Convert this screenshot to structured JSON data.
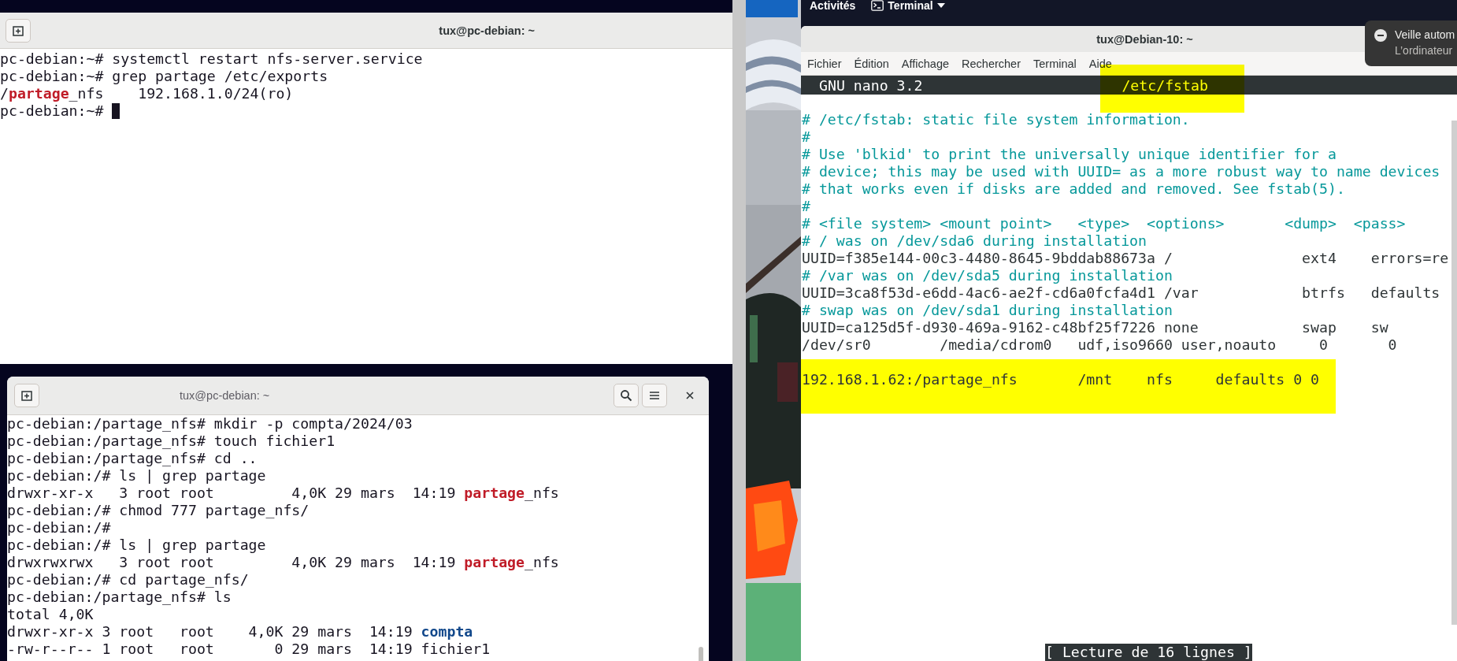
{
  "left_desktop": {
    "top_terminal": {
      "title": "tux@pc-debian: ~",
      "lines": [
        {
          "parts": [
            {
              "text": "pc-debian:~# systemctl restart nfs-server.service",
              "kind": "plain"
            }
          ],
          "cursor": false
        },
        {
          "parts": [
            {
              "text": "pc-debian:~# grep partage /etc/exports",
              "kind": "plain"
            }
          ],
          "cursor": false
        },
        {
          "parts": [
            {
              "text": "/",
              "kind": "plain"
            },
            {
              "text": "partage",
              "kind": "match"
            },
            {
              "text": "_nfs    192.168.1.0/24(ro)",
              "kind": "plain"
            }
          ],
          "cursor": false
        },
        {
          "parts": [
            {
              "text": "pc-debian:~#",
              "kind": "plain"
            }
          ],
          "cursor": true
        }
      ]
    },
    "bottom_terminal": {
      "title": "tux@pc-debian: ~",
      "lines": [
        {
          "parts": [
            {
              "text": "pc-debian:/partage_nfs# mkdir -p compta/2024/03",
              "kind": "plain"
            }
          ],
          "cursor": false
        },
        {
          "parts": [
            {
              "text": "pc-debian:/partage_nfs# touch fichier1",
              "kind": "plain"
            }
          ],
          "cursor": false
        },
        {
          "parts": [
            {
              "text": "pc-debian:/partage_nfs# cd ..",
              "kind": "plain"
            }
          ],
          "cursor": false
        },
        {
          "parts": [
            {
              "text": "pc-debian:/# ls | grep partage",
              "kind": "plain"
            }
          ],
          "cursor": false
        },
        {
          "parts": [
            {
              "text": "drwxr-xr-x   3 root root         4,0K 29 mars  14:19 ",
              "kind": "plain"
            },
            {
              "text": "partage",
              "kind": "match"
            },
            {
              "text": "_nfs",
              "kind": "plain"
            }
          ],
          "cursor": false
        },
        {
          "parts": [
            {
              "text": "pc-debian:/# chmod 777 partage_nfs/",
              "kind": "plain"
            }
          ],
          "cursor": false
        },
        {
          "parts": [
            {
              "text": "pc-debian:/#",
              "kind": "plain"
            }
          ],
          "cursor": false
        },
        {
          "parts": [
            {
              "text": "pc-debian:/# ls | grep partage",
              "kind": "plain"
            }
          ],
          "cursor": false
        },
        {
          "parts": [
            {
              "text": "drwxrwxrwx   3 root root         4,0K 29 mars  14:19 ",
              "kind": "plain"
            },
            {
              "text": "partage",
              "kind": "match"
            },
            {
              "text": "_nfs",
              "kind": "plain"
            }
          ],
          "cursor": false
        },
        {
          "parts": [
            {
              "text": "pc-debian:/# cd partage_nfs/",
              "kind": "plain"
            }
          ],
          "cursor": false
        },
        {
          "parts": [
            {
              "text": "pc-debian:/partage_nfs# ls",
              "kind": "plain"
            }
          ],
          "cursor": false
        },
        {
          "parts": [
            {
              "text": "total 4,0K",
              "kind": "plain"
            }
          ],
          "cursor": false
        },
        {
          "parts": [
            {
              "text": "drwxr-xr-x 3 root   root    4,0K 29 mars  14:19 ",
              "kind": "plain"
            },
            {
              "text": "compta",
              "kind": "dir"
            }
          ],
          "cursor": false
        },
        {
          "parts": [
            {
              "text": "-rw-r--r-- 1 root   root       0 29 mars  14:19 fichier1",
              "kind": "plain"
            }
          ],
          "cursor": false
        }
      ]
    }
  },
  "right_screen": {
    "top_bar": {
      "activities": "Activités",
      "app_menu": "Terminal"
    },
    "terminal": {
      "title": "tux@Debian-10: ~",
      "menu": [
        "Fichier",
        "Édition",
        "Affichage",
        "Rechercher",
        "Terminal",
        "Aide"
      ],
      "nano_bar": {
        "version": "GNU nano 3.2",
        "filename": "/etc/fstab",
        "highlighted": true
      },
      "lines": [
        {
          "kind": "comment",
          "text": "# /etc/fstab: static file system information.",
          "highlighted": false
        },
        {
          "kind": "comment",
          "text": "#",
          "highlighted": false
        },
        {
          "kind": "comment",
          "text": "# Use 'blkid' to print the universally unique identifier for a",
          "highlighted": false
        },
        {
          "kind": "comment",
          "text": "# device; this may be used with UUID= as a more robust way to name devices",
          "highlighted": false
        },
        {
          "kind": "comment",
          "text": "# that works even if disks are added and removed. See fstab(5).",
          "highlighted": false
        },
        {
          "kind": "comment",
          "text": "#",
          "highlighted": false
        },
        {
          "kind": "comment",
          "text": "# <file system> <mount point>   <type>  <options>       <dump>  <pass>",
          "highlighted": false
        },
        {
          "kind": "comment",
          "text": "# / was on /dev/sda6 during installation",
          "highlighted": false
        },
        {
          "kind": "plain",
          "text": "UUID=f385e144-00c3-4480-8645-9bddab88673a /               ext4    errors=re",
          "highlighted": false
        },
        {
          "kind": "comment",
          "text": "# /var was on /dev/sda5 during installation",
          "highlighted": false
        },
        {
          "kind": "plain",
          "text": "UUID=3ca8f53d-e6dd-4ac6-ae2f-cd6a0fcfa4d1 /var            btrfs   defaults",
          "highlighted": false
        },
        {
          "kind": "comment",
          "text": "# swap was on /dev/sda1 during installation",
          "highlighted": false
        },
        {
          "kind": "plain",
          "text": "UUID=ca125d5f-d930-469a-9162-c48bf25f7226 none            swap    sw",
          "highlighted": false
        },
        {
          "kind": "plain",
          "text": "/dev/sr0        /media/cdrom0   udf,iso9660 user,noauto     0       0",
          "highlighted": false
        },
        {
          "kind": "blank",
          "highlighted": false
        },
        {
          "kind": "plain",
          "text": "192.168.1.62:/partage_nfs       /mnt    nfs     defaults 0 0",
          "highlighted": true
        }
      ],
      "status": "[ Lecture de 16 lignes ]"
    },
    "notification": {
      "title": "Veille autom",
      "body": "L’ordinateur"
    }
  }
}
